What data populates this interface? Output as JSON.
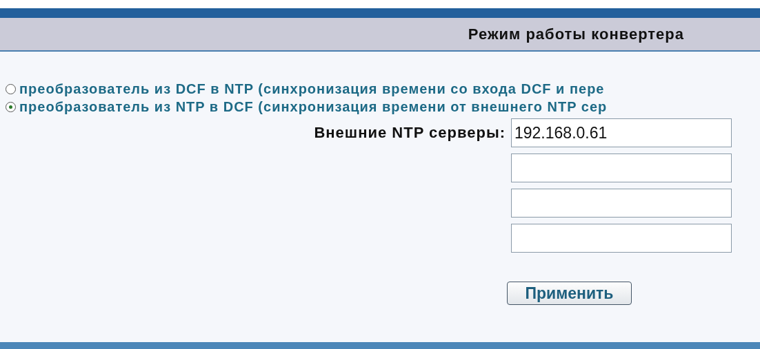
{
  "header": {
    "title": "Режим работы конвертера"
  },
  "modes": [
    {
      "label": "преобразователь из DCF в NTP (синхронизация времени со входа DCF и пере",
      "selected": false
    },
    {
      "label": "преобразователь из NTP в DCF (синхронизация времени от внешнего NTP сер",
      "selected": true
    }
  ],
  "servers": {
    "label": "Внешние NTP серверы:",
    "fields": [
      {
        "kind": "text",
        "value": "192.168.0.61"
      },
      {
        "kind": "text"
      },
      {
        "kind": "text"
      },
      {
        "kind": "text"
      }
    ]
  },
  "apply_button": "Применить"
}
